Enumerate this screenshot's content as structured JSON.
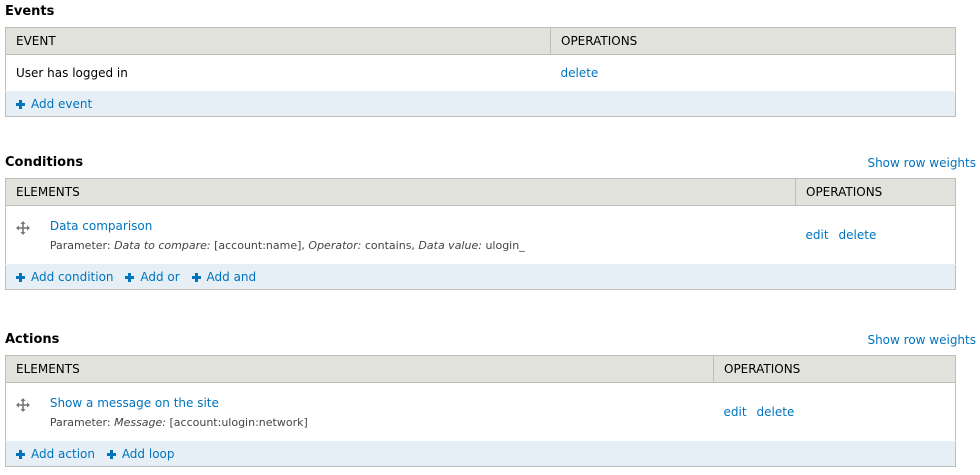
{
  "events": {
    "heading": "Events",
    "columns": {
      "event": "EVENT",
      "operations": "OPERATIONS"
    },
    "rows": [
      {
        "label": "User has logged in",
        "delete": "delete"
      }
    ],
    "add_event": "Add event"
  },
  "conditions": {
    "heading": "Conditions",
    "show_weights": "Show row weights",
    "columns": {
      "elements": "ELEMENTS",
      "operations": "OPERATIONS"
    },
    "rows": [
      {
        "title": "Data comparison",
        "param_prefix": "Parameter:",
        "p1_label": "Data to compare:",
        "p1_value": "[account:name],",
        "p2_label": "Operator:",
        "p2_value": "contains,",
        "p3_label": "Data value:",
        "p3_value": "ulogin_",
        "edit": "edit",
        "delete": "delete"
      }
    ],
    "add_condition": "Add condition",
    "add_or": "Add or",
    "add_and": "Add and"
  },
  "actions": {
    "heading": "Actions",
    "show_weights": "Show row weights",
    "columns": {
      "elements": "ELEMENTS",
      "operations": "OPERATIONS"
    },
    "rows": [
      {
        "title": "Show a message on the site",
        "param_prefix": "Parameter:",
        "p1_label": "Message:",
        "p1_value": "[account:ulogin:network]",
        "edit": "edit",
        "delete": "delete"
      }
    ],
    "add_action": "Add action",
    "add_loop": "Add loop"
  },
  "colors": {
    "link": "#0074bd",
    "header_bg": "#e1e2dc",
    "add_row_bg": "#e6eff5",
    "border": "#bebfb9"
  },
  "icons": {
    "drag": "move-arrows-icon",
    "add": "plus-icon"
  }
}
